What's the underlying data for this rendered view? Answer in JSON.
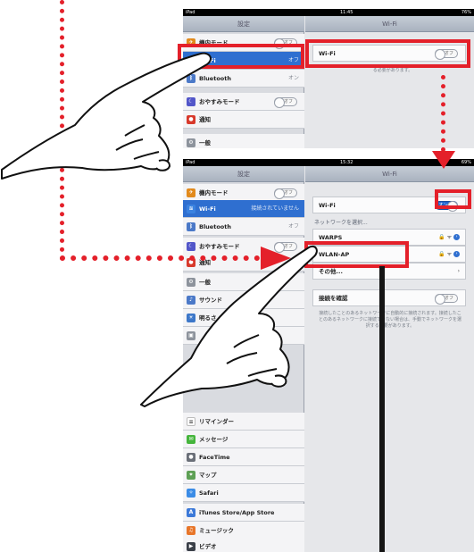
{
  "top_screen": {
    "status": {
      "left": "iPad",
      "center": "11:45",
      "right": "76%"
    },
    "sidebar_title": "設定",
    "panel_title": "Wi-Fi",
    "sidebar_items": [
      {
        "label": "機内モード",
        "toggle": "オフ",
        "icon_color": "#e28a1c"
      },
      {
        "label": "Wi-Fi",
        "value": "オフ",
        "icon_color": "#3a82e0",
        "selected": true
      },
      {
        "label": "Bluetooth",
        "value": "オン",
        "icon_color": "#4b79c8"
      },
      {
        "label": "おやすみモード",
        "toggle": "オフ",
        "icon_color": "#5256c9"
      },
      {
        "label": "通知",
        "icon_color": "#d8392b"
      },
      {
        "label": "一般",
        "icon_color": "#8d939c"
      }
    ],
    "wifi_row": {
      "label": "Wi-Fi",
      "toggle": "オフ"
    },
    "footnote": "る必要があります。"
  },
  "bottom_screen": {
    "status": {
      "left": "iPad",
      "center": "15:32",
      "right": "69%"
    },
    "sidebar_title": "設定",
    "panel_title": "Wi-Fi",
    "sidebar_items": [
      {
        "label": "機内モード",
        "toggle": "オフ",
        "icon_color": "#e28a1c"
      },
      {
        "label": "Wi-Fi",
        "value": "接続されていません",
        "icon_color": "#3a82e0",
        "selected": true
      },
      {
        "label": "Bluetooth",
        "value": "オフ",
        "icon_color": "#4b79c8"
      },
      {
        "label": "おやすみモード",
        "toggle": "オフ",
        "icon_color": "#5256c9"
      },
      {
        "label": "通知",
        "icon_color": "#d8392b"
      },
      {
        "label": "一般",
        "icon_color": "#8d939c"
      },
      {
        "label": "サウンド",
        "icon_color": "#4b79c8"
      },
      {
        "label": "明るさ",
        "icon_color": "#3c77c9"
      },
      {
        "label": "",
        "icon_color": "#8d939c"
      }
    ],
    "lower_sidebar_items": [
      {
        "label": "リマインダー",
        "icon_color": "#ffffff"
      },
      {
        "label": "メッセージ",
        "icon_color": "#45b53c"
      },
      {
        "label": "FaceTime",
        "icon_color": "#6a6f78"
      },
      {
        "label": "マップ",
        "icon_color": "#5ea055"
      },
      {
        "label": "Safari",
        "icon_color": "#3b8ce6"
      },
      {
        "label": "iTunes Store/App Store",
        "icon_color": "#3c79d8"
      },
      {
        "label": "ミュージック",
        "icon_color": "#e8762a"
      },
      {
        "label": "ビデオ",
        "icon_color": "#3a3f48"
      }
    ],
    "wifi_row": {
      "label": "Wi-Fi",
      "toggle": "オン"
    },
    "choose_network": "ネットワークを選択...",
    "networks": [
      {
        "name": "WARPS",
        "signal": "🔒 ᯤ"
      },
      {
        "name": "WLAN-AP",
        "signal": "🔒 ᯤ"
      },
      {
        "name": "その他...",
        "signal": "›"
      }
    ],
    "ask_join": {
      "label": "接続を確認",
      "toggle": "オフ"
    },
    "footnote": "接続したことのあるネットワークに自動的に接続されます。接続したことのあるネットワークに接続できない場合は、手動でネットワークを選択する必要があります。"
  },
  "colors": {
    "annotation_red": "#e4202a",
    "selected_blue": "#2f6fd0"
  }
}
